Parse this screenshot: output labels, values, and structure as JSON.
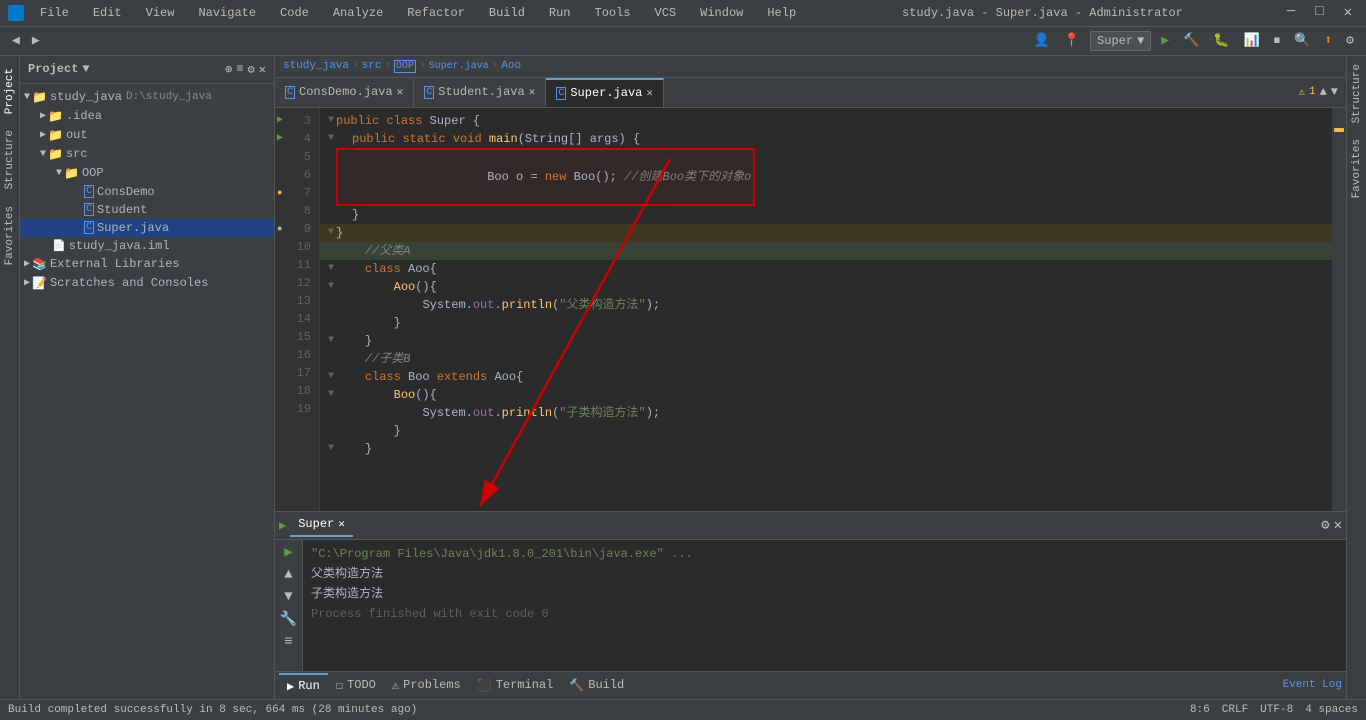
{
  "titlebar": {
    "title": "study.java - Super.java - Administrator",
    "min_btn": "─",
    "max_btn": "□",
    "close_btn": "✕"
  },
  "menubar": {
    "items": [
      "File",
      "Edit",
      "View",
      "Navigate",
      "Code",
      "Analyze",
      "Refactor",
      "Build",
      "Run",
      "Tools",
      "VCS",
      "Window",
      "Help"
    ]
  },
  "breadcrumb": {
    "parts": [
      "study_java",
      "src",
      "OOP",
      "Super.java",
      "Aoo"
    ]
  },
  "tabs": [
    {
      "label": "ConsDemo.java",
      "icon": "C",
      "active": false
    },
    {
      "label": "Student.java",
      "icon": "C",
      "active": false
    },
    {
      "label": "Super.java",
      "icon": "C",
      "active": true
    }
  ],
  "project": {
    "title": "Project",
    "tree": [
      {
        "label": "study_java",
        "path": "D:\\study_java",
        "level": 0,
        "type": "project"
      },
      {
        "label": ".idea",
        "level": 1,
        "type": "folder",
        "collapsed": true
      },
      {
        "label": "out",
        "level": 1,
        "type": "folder",
        "collapsed": true
      },
      {
        "label": "src",
        "level": 1,
        "type": "folder",
        "expanded": true
      },
      {
        "label": "OOP",
        "level": 2,
        "type": "folder",
        "expanded": true
      },
      {
        "label": "ConsDemo",
        "level": 3,
        "type": "java"
      },
      {
        "label": "Student",
        "level": 3,
        "type": "java"
      },
      {
        "label": "Super.java",
        "level": 3,
        "type": "java",
        "selected": true
      },
      {
        "label": "study_java.iml",
        "level": 1,
        "type": "iml"
      },
      {
        "label": "External Libraries",
        "level": 0,
        "type": "lib"
      },
      {
        "label": "Scratches and Consoles",
        "level": 0,
        "type": "scratch"
      }
    ]
  },
  "code": {
    "lines": [
      {
        "num": 3,
        "content": "public class Super {",
        "indent": 0
      },
      {
        "num": 4,
        "content": "    public static void main(String[] args) {",
        "indent": 0
      },
      {
        "num": 5,
        "content": "        Boo o = new Boo(); //创建Boo类下的对象o",
        "indent": 0,
        "highlight": true
      },
      {
        "num": 6,
        "content": "    }",
        "indent": 0
      },
      {
        "num": 7,
        "content": "}",
        "indent": 0
      },
      {
        "num": 8,
        "content": "    //父类A",
        "indent": 0
      },
      {
        "num": 9,
        "content": "    class Aoo{",
        "indent": 0
      },
      {
        "num": 10,
        "content": "        Aoo(){",
        "indent": 0
      },
      {
        "num": 11,
        "content": "            System.out.println(\"父类构造方法\");",
        "indent": 0
      },
      {
        "num": 12,
        "content": "        }",
        "indent": 0
      },
      {
        "num": 13,
        "content": "    }",
        "indent": 0
      },
      {
        "num": 14,
        "content": "    //子类B",
        "indent": 0
      },
      {
        "num": 15,
        "content": "    class Boo extends Aoo{",
        "indent": 0
      },
      {
        "num": 16,
        "content": "        Boo(){",
        "indent": 0
      },
      {
        "num": 17,
        "content": "            System.out.println(\"子类构造方法\");",
        "indent": 0
      },
      {
        "num": 18,
        "content": "        }",
        "indent": 0
      },
      {
        "num": 19,
        "content": "    }",
        "indent": 0
      }
    ]
  },
  "run": {
    "tab_label": "Super",
    "command": "\"C:\\Program Files\\Java\\jdk1.8.0_201\\bin\\java.exe\" ...",
    "output": [
      "父类构造方法",
      "子类构造方法"
    ],
    "more_text": "Process finished with exit code 0"
  },
  "bottom_tabs": [
    "Run",
    "TODO",
    "Problems",
    "Terminal",
    "Build"
  ],
  "statusbar": {
    "build_msg": "Build completed successfully in 8 sec, 664 ms (28 minutes ago)",
    "position": "8:6",
    "encoding": "CRLF",
    "charset": "UTF-8",
    "indent": "4 spaces",
    "event_log": "Event Log",
    "warnings": "1"
  },
  "toolbar": {
    "config_label": "Super",
    "run_label": "▶",
    "build_label": "🔨",
    "debug_label": "🐛"
  }
}
